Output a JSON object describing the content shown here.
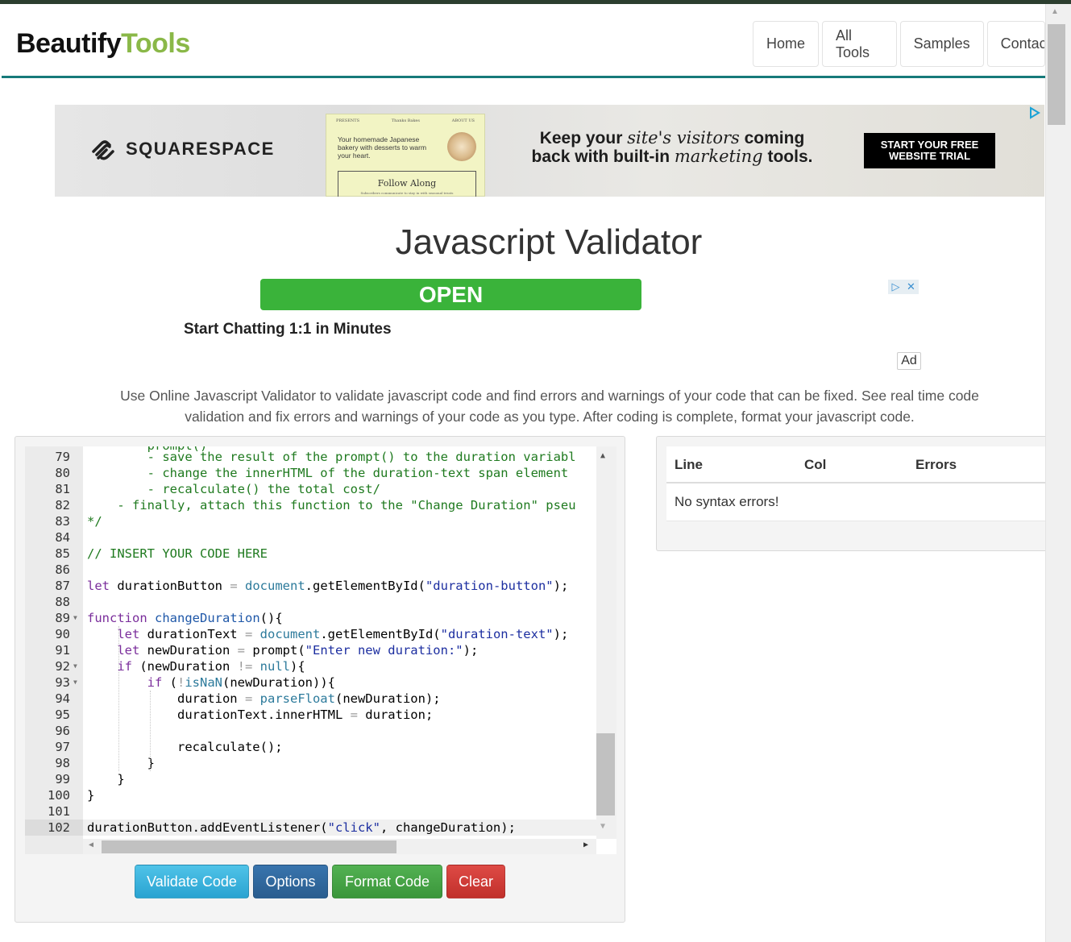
{
  "header": {
    "logo_part1": "Beautify",
    "logo_part2": "Tools",
    "nav": [
      "Home",
      "All Tools",
      "Samples",
      "Contact"
    ]
  },
  "ad_banner": {
    "brand": "SQUARESPACE",
    "mock_header_left": "PRESENTS",
    "mock_header_center": "Thanks Bakes",
    "mock_header_right": "ABOUT US",
    "mock_text": "Your homemade Japanese bakery with desserts to warm your heart.",
    "mock_button": "Follow Along",
    "mock_button_sub": "Subscribers communicate to stay in with seasonal treats",
    "headline_line1_a": "Keep your ",
    "headline_line1_b": "site's visitors",
    "headline_line1_c": " coming",
    "headline_line2_a": "back with built-in ",
    "headline_line2_b": "marketing",
    "headline_line2_c": " tools.",
    "cta": "START YOUR FREE WEBSITE TRIAL",
    "choices_icon": "adchoices-icon"
  },
  "page_title": "Javascript Validator",
  "ad2": {
    "button": "OPEN",
    "text": "Start Chatting 1:1 in Minutes",
    "ad_label": "Ad"
  },
  "description": "Use Online Javascript Validator to validate javascript code and find errors and warnings of your code that can be fixed. See real time code validation and fix errors and warnings of your code as you type. After coding is complete, format your javascript code.",
  "editor": {
    "line_numbers": [
      "79",
      "80",
      "81",
      "82",
      "83",
      "84",
      "85",
      "86",
      "87",
      "88",
      "89",
      "90",
      "91",
      "92",
      "93",
      "94",
      "95",
      "96",
      "97",
      "98",
      "99",
      "100",
      "101",
      "102"
    ],
    "lines": [
      "        - save the result of the prompt() to the duration variabl",
      "        - change the innerHTML of the duration-text span element",
      "        - recalculate() the total cost/",
      "    - finally, attach this function to the \"Change Duration\" pseu",
      "*/",
      "",
      "// INSERT YOUR CODE HERE",
      "",
      "let durationButton = document.getElementById(\"duration-button\");",
      "",
      "function changeDuration(){",
      "    let durationText = document.getElementById(\"duration-text\");",
      "    let newDuration = prompt(\"Enter new duration:\");",
      "    if (newDuration != null){",
      "        if (!isNaN(newDuration)){",
      "            duration = parseFloat(newDuration);",
      "            durationText.innerHTML = duration;",
      "",
      "            recalculate();",
      "        }",
      "    }",
      "}",
      "",
      "durationButton.addEventListener(\"click\", changeDuration);"
    ],
    "partial_top_line": "        prompt()"
  },
  "buttons": {
    "validate": "Validate Code",
    "options": "Options",
    "format": "Format Code",
    "clear": "Clear"
  },
  "errors": {
    "col_line": "Line",
    "col_col": "Col",
    "col_errors": "Errors",
    "message": "No syntax errors!"
  }
}
